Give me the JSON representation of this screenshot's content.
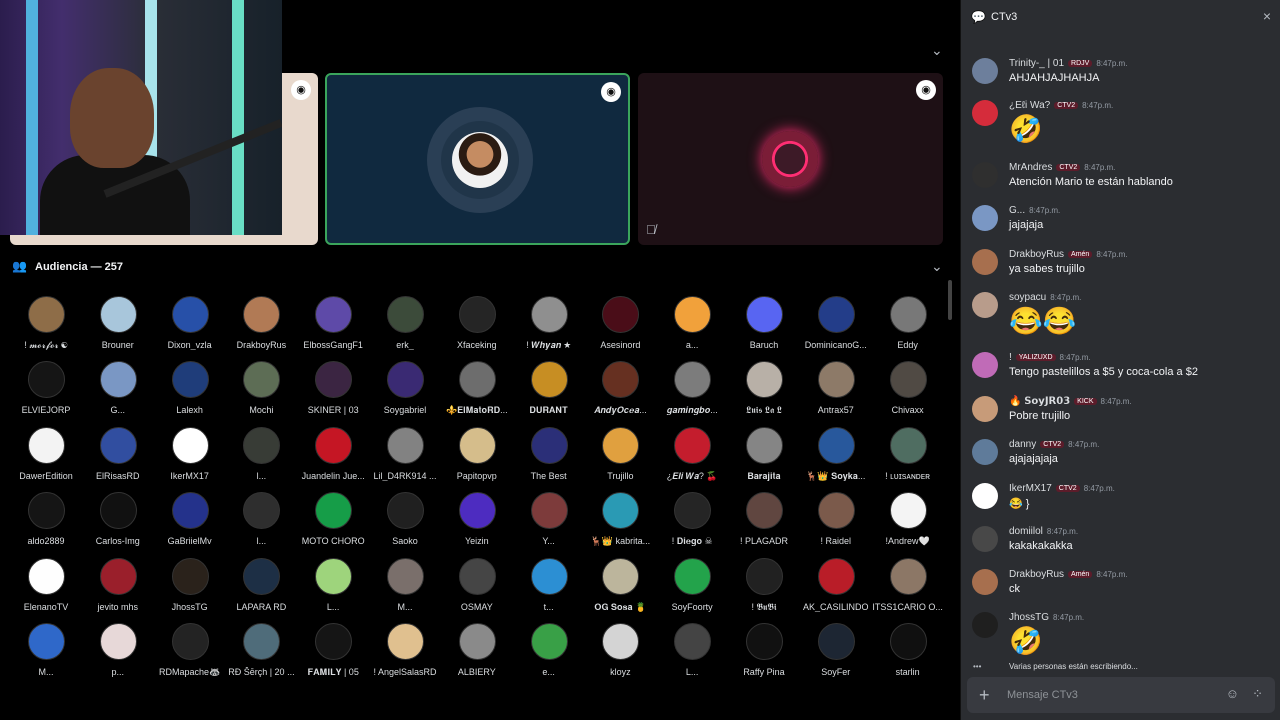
{
  "chat": {
    "channel_name": "CTv3",
    "placeholder": "Mensaje CTv3",
    "typing": "Varias personas están escribiendo...",
    "messages": [
      {
        "author": "Trinity-_ | 01",
        "badge": "RDJV",
        "time": "8:47p.m.",
        "text": "AHJAHJAJHAHJA",
        "avatar_color": "#6d7f9c"
      },
      {
        "author": "¿Eℓi Wa?",
        "badge": "CTV2",
        "time": "8:47p.m.",
        "text": "🤣",
        "avatar_color": "#d52c3b",
        "large_emoji": true
      },
      {
        "author": "MrAndres",
        "badge": "CTV2",
        "time": "8:47p.m.",
        "text": "Atención Mario te están hablando",
        "avatar_color": "#2f2f2f"
      },
      {
        "author": "G...",
        "badge": "",
        "time": "8:47p.m.",
        "text": "jajajaja",
        "avatar_color": "#7a97c4"
      },
      {
        "author": "DrakboyRus",
        "badge": "Amén",
        "time": "8:47p.m.",
        "text": "ya sabes trujillo",
        "avatar_color": "#a76f4e"
      },
      {
        "author": "soypacu",
        "badge": "",
        "time": "8:47p.m.",
        "text": "😂😂",
        "avatar_color": "#b89c8b",
        "large_emoji": true
      },
      {
        "author": "!",
        "badge": "YALIZUXD",
        "time": "8:47p.m.",
        "text": "Tengo pastelillos a $5 y coca-cola a $2",
        "avatar_color": "#c06bb7"
      },
      {
        "author": "🔥 𝗦𝗼𝘆𝗝𝗥𝟬𝟯",
        "badge": "KICK",
        "time": "8:47p.m.",
        "text": "Pobre trujillo",
        "avatar_color": "#c79b79"
      },
      {
        "author": "danny",
        "badge": "CTV2",
        "time": "8:47p.m.",
        "text": "ajajajajaja",
        "avatar_color": "#5f7b9a"
      },
      {
        "author": "IkerMX17",
        "badge": "CTV2",
        "time": "8:47p.m.",
        "text": "😂 }",
        "avatar_color": "#ffffff"
      },
      {
        "author": "domiilol",
        "badge": "",
        "time": "8:47p.m.",
        "text": "kakakakakka",
        "avatar_color": "#484848"
      },
      {
        "author": "DrakboyRus",
        "badge": "Amén",
        "time": "8:47p.m.",
        "text": "ck",
        "avatar_color": "#a76f4e"
      },
      {
        "author": "JhossTG",
        "badge": "",
        "time": "8:47p.m.",
        "text": "🤣",
        "avatar_color": "#1f1f1f",
        "large_emoji": true
      }
    ]
  },
  "audience": {
    "title": "Audiencia — 257",
    "people": [
      {
        "name": "! 𝓶𝓸𝓻𝓯𝓸𝓻 ☯",
        "color": "#8e6d48"
      },
      {
        "name": "Brouner",
        "color": "#a8c6db"
      },
      {
        "name": "Dixon_vzla",
        "color": "#2750a8"
      },
      {
        "name": "DrakboyRus",
        "color": "#b17a55"
      },
      {
        "name": "ElbossGangF1",
        "color": "#5e4aa8"
      },
      {
        "name": "erk_",
        "color": "#3c4b3a"
      },
      {
        "name": "Xfaceking",
        "color": "#252525"
      },
      {
        "name": "! 𝑾𝒉𝒚𝒂𝒏 ★",
        "color": "#8f8f8f"
      },
      {
        "name": "Asesinord",
        "color": "#4a0d18"
      },
      {
        "name": "a...",
        "color": "#f1a13b"
      },
      {
        "name": "Baruch",
        "color": "#5865f2"
      },
      {
        "name": "DominicanoG...",
        "color": "#233d89"
      },
      {
        "name": "Eddy",
        "color": "#787878"
      },
      {
        "name": "ELVIEJORP",
        "color": "#151515"
      },
      {
        "name": "G...",
        "color": "#7a97c4"
      },
      {
        "name": "Lalexh",
        "color": "#1f3d7a"
      },
      {
        "name": "Mochi",
        "color": "#5d6d55"
      },
      {
        "name": "SKINER | 03",
        "color": "#3b2542"
      },
      {
        "name": "Soygabriel",
        "color": "#3a2a73"
      },
      {
        "name": "⚜️𝐄𝐥𝐌𝐚𝐭𝐨𝐑𝐃...",
        "color": "#6d6d6d"
      },
      {
        "name": "𝐃𝐔𝐑𝐀𝐍𝐓",
        "color": "#c78e23"
      },
      {
        "name": "𝑨𝒏𝒅𝒚𝑶𝒄𝒆𝒂...",
        "color": "#663021"
      },
      {
        "name": "𝒈𝒂𝒎𝒊𝒏𝒈𝒃𝒐...",
        "color": "#7c7c7c"
      },
      {
        "name": "𝕷𝖚𝖎𝖘 𝕷𝖆 𝕷",
        "color": "#b8b0a7"
      },
      {
        "name": "Antrax57",
        "color": "#8d7a68"
      },
      {
        "name": "Chivaxx",
        "color": "#504a44"
      },
      {
        "name": "DawerEdition",
        "color": "#f3f3f3"
      },
      {
        "name": "ElRisasRD",
        "color": "#314ea0"
      },
      {
        "name": "IkerMX17",
        "color": "#ffffff"
      },
      {
        "name": "l...",
        "color": "#383c36"
      },
      {
        "name": "Juandelin Jue...",
        "color": "#c51624"
      },
      {
        "name": "Lil_D4RK914 ...",
        "color": "#828282"
      },
      {
        "name": "Papitopvp",
        "color": "#d5bd8b"
      },
      {
        "name": "The Best",
        "color": "#2b2f78"
      },
      {
        "name": "Trujillo",
        "color": "#e0a03f"
      },
      {
        "name": "¿𝑬𝒍𝒊 𝑾𝒂? 🍒",
        "color": "#c41d2d"
      },
      {
        "name": "𝐁𝐚𝐫𝐚𝐣𝐢𝐭𝐚",
        "color": "#858585"
      },
      {
        "name": "🦌👑 𝐒𝐨𝐲𝐤𝐚...",
        "color": "#28589c"
      },
      {
        "name": "! ʟᴜɪsᴀɴᴅᴇʀ",
        "color": "#4f6d61"
      },
      {
        "name": "aldo2889",
        "color": "#151515"
      },
      {
        "name": "Carlos-Img",
        "color": "#111111"
      },
      {
        "name": "GaBriielMv",
        "color": "#24328b"
      },
      {
        "name": "l...",
        "color": "#2e2e2e"
      },
      {
        "name": "MOTO CHORO",
        "color": "#169d48"
      },
      {
        "name": "Saoko",
        "color": "#202020"
      },
      {
        "name": "Yeizin",
        "color": "#4d2cc0"
      },
      {
        "name": "Y...",
        "color": "#7d3b3b"
      },
      {
        "name": "🦌👑 kabrita...",
        "color": "#2a9ab4"
      },
      {
        "name": "! 𝐃𝐢𝐞𝐠𝐨 ☠",
        "color": "#252525"
      },
      {
        "name": "! PLAGADR",
        "color": "#604640"
      },
      {
        "name": "! Raidel",
        "color": "#7b5a4b"
      },
      {
        "name": "!Andrew🤍",
        "color": "#f4f4f4"
      },
      {
        "name": "ElenanoTV",
        "color": "#fefefe"
      },
      {
        "name": "jevito mhs",
        "color": "#9a1f2b"
      },
      {
        "name": "JhossTG",
        "color": "#2a221b"
      },
      {
        "name": "LAPARA RD",
        "color": "#1d2f45"
      },
      {
        "name": "L...",
        "color": "#9ed47c"
      },
      {
        "name": "M...",
        "color": "#7a6f6b"
      },
      {
        "name": "OSMAY",
        "color": "#454545"
      },
      {
        "name": "t...",
        "color": "#2c8fd3"
      },
      {
        "name": "𝐎𝐆 𝐒𝐨𝐬𝐚 🍍",
        "color": "#bcb59c"
      },
      {
        "name": "SoyFoorty",
        "color": "#23a34b"
      },
      {
        "name": "! 𝕭𝖚𝕭𝖎",
        "color": "#212121"
      },
      {
        "name": "AK_CASILINDO",
        "color": "#b91d28"
      },
      {
        "name": "ITSS1CARIO O...",
        "color": "#8c7766"
      },
      {
        "name": "M...",
        "color": "#2f68c9"
      },
      {
        "name": "p...",
        "color": "#e7d8d8"
      },
      {
        "name": "RDMapache🦝",
        "color": "#232323"
      },
      {
        "name": "RĐ Šērçh | 20 ...",
        "color": "#4f6c7a"
      },
      {
        "name": "𝐅𝐀𝐌𝐈𝐋𝐘 | 05",
        "color": "#151515"
      },
      {
        "name": "! AngelSalasRD",
        "color": "#e0c08f"
      },
      {
        "name": "ALBIERY",
        "color": "#8a8a8a"
      },
      {
        "name": "e...",
        "color": "#39a047"
      },
      {
        "name": "kloyz",
        "color": "#d4d4d4"
      },
      {
        "name": "L...",
        "color": "#444444"
      },
      {
        "name": "Raffy Pina",
        "color": "#111111"
      },
      {
        "name": "SoyFer",
        "color": "#1d2633"
      },
      {
        "name": "starlin",
        "color": "#101010"
      }
    ]
  }
}
